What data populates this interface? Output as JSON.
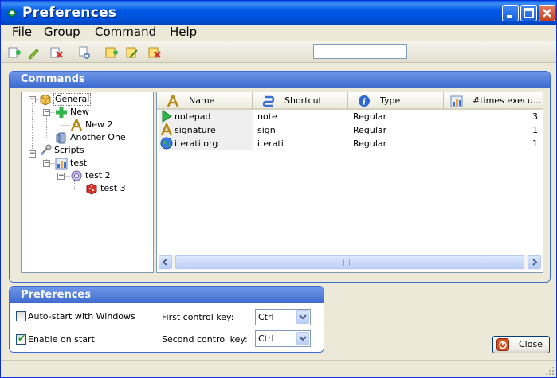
{
  "window": {
    "title": "Preferences"
  },
  "menu": [
    "File",
    "Group",
    "Command",
    "Help"
  ],
  "toolbar": {
    "buttons": [
      "add-group-icon",
      "edit-group-icon",
      "delete-group-icon",
      "import-icon",
      "add-command-icon",
      "edit-command-icon",
      "delete-command-icon"
    ],
    "search_value": ""
  },
  "commands": {
    "title": "Commands",
    "tree": [
      {
        "label": "General",
        "icon": "box-icon"
      },
      {
        "label": "New",
        "icon": "plus-icon"
      },
      {
        "label": "New 2",
        "icon": "text-icon"
      },
      {
        "label": "Another One",
        "icon": "cylinder-icon"
      },
      {
        "label": "Scripts",
        "icon": "script-icon"
      },
      {
        "label": "test",
        "icon": "chart-icon"
      },
      {
        "label": "test 2",
        "icon": "gear-icon"
      },
      {
        "label": "test 3",
        "icon": "dice-icon"
      }
    ],
    "columns": [
      "Name",
      "Shortcut",
      "Type",
      "#times execu..."
    ],
    "rows": [
      {
        "name": "notepad",
        "shortcut": "note",
        "type": "Regular",
        "times": "3",
        "icon": "play-icon"
      },
      {
        "name": "signature",
        "shortcut": "sign",
        "type": "Regular",
        "times": "1",
        "icon": "text-icon"
      },
      {
        "name": "iterati.org",
        "shortcut": "iterati",
        "type": "Regular",
        "times": "1",
        "icon": "globe-icon"
      }
    ]
  },
  "preferences": {
    "title": "Preferences",
    "autostart_label": "Auto-start with Windows",
    "autostart_checked": false,
    "enable_label": "Enable on start",
    "enable_checked": true,
    "first_key_label": "First control key:",
    "first_key_value": "Ctrl",
    "second_key_label": "Second control key:",
    "second_key_value": "Ctrl"
  },
  "close_button": "Close"
}
